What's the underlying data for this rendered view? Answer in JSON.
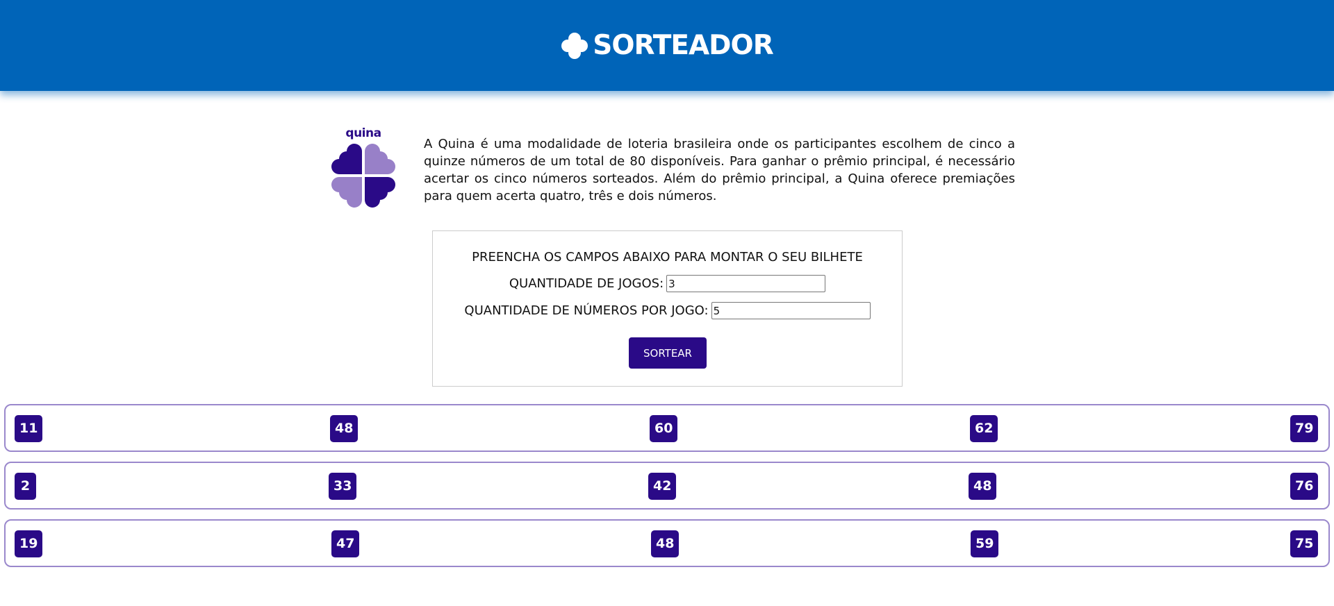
{
  "header": {
    "title": "SORTEADOR",
    "icon": "clover-icon"
  },
  "intro": {
    "logo_label": "quina",
    "text": "A Quina é uma modalidade de loteria brasileira onde os participantes escolhem de cinco a quinze números de um total de 80 disponíveis. Para ganhar o prêmio principal, é necessário acertar os cinco números sorteados. Além do prêmio principal, a Quina oferece premiações para quem acerta quatro, três e dois números."
  },
  "form": {
    "title": "PREENCHA OS CAMPOS ABAIXO PARA MONTAR O SEU BILHETE",
    "games_label": "QUANTIDADE DE JOGOS:",
    "games_value": "3",
    "numbers_label": "QUANTIDADE DE NÚMEROS POR JOGO:",
    "numbers_value": "5",
    "button_label": "SORTEAR"
  },
  "games": [
    [
      "11",
      "48",
      "60",
      "62",
      "79"
    ],
    [
      "2",
      "33",
      "42",
      "48",
      "76"
    ],
    [
      "19",
      "47",
      "48",
      "59",
      "75"
    ]
  ],
  "colors": {
    "header_bg": "#0064b8",
    "brand_purple": "#2a0a87",
    "light_purple": "#9880c8",
    "row_border": "#9a88cc"
  }
}
